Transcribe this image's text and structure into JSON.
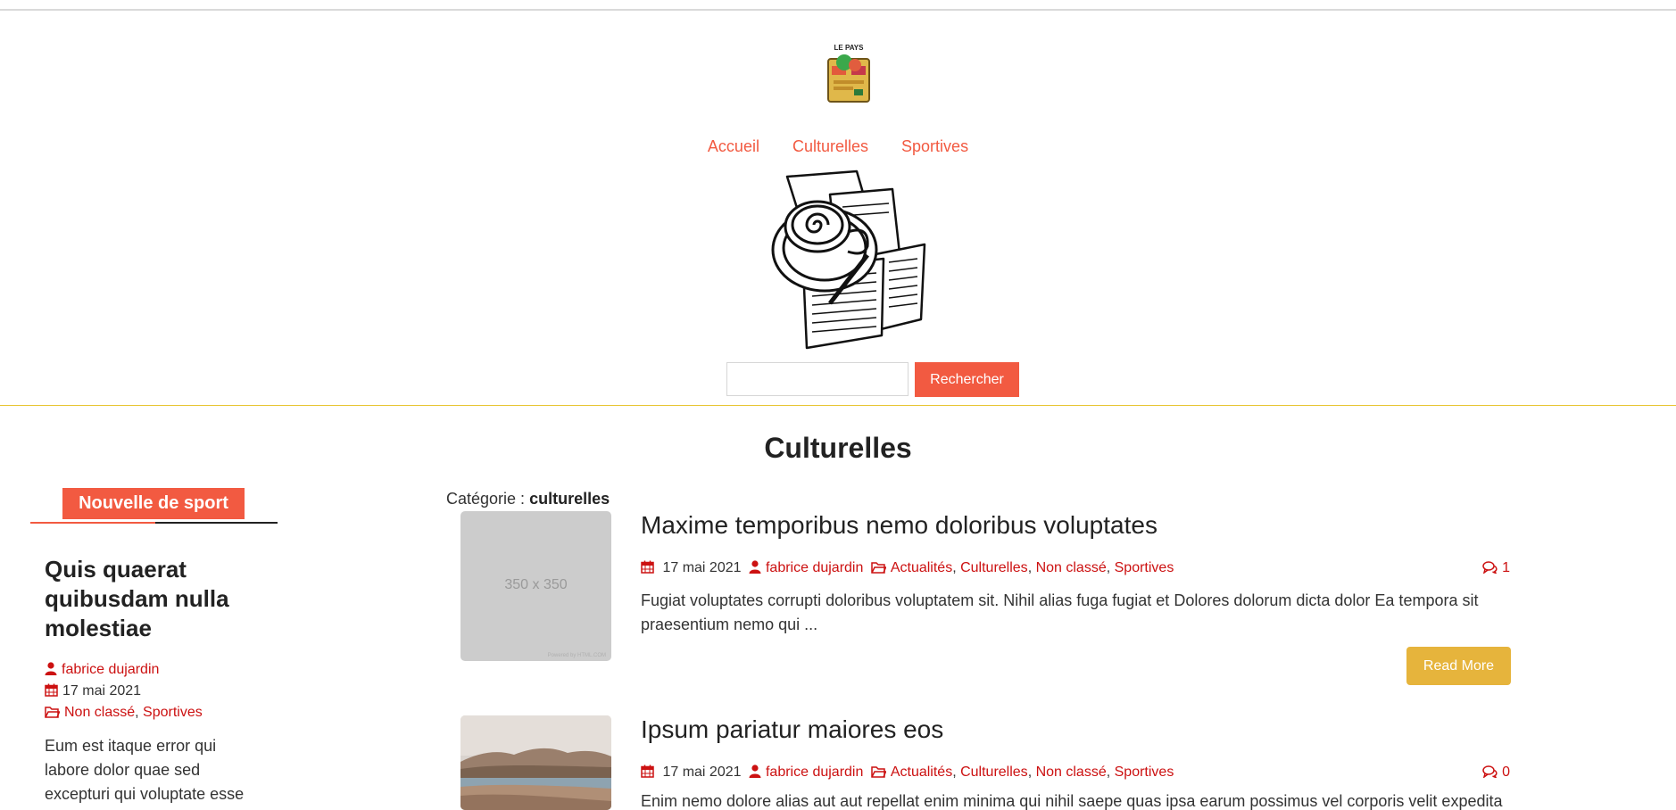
{
  "site": {
    "name": "LE PAYS"
  },
  "nav": {
    "items": [
      "Accueil",
      "Culturelles",
      "Sportives"
    ]
  },
  "search": {
    "value": "",
    "button_label": "Rechercher"
  },
  "page": {
    "title": "Culturelles"
  },
  "category": {
    "prefix": "Catégorie :",
    "name": "culturelles"
  },
  "sidebar": {
    "heading": "Nouvelle de sport",
    "post": {
      "title": "Quis quaerat quibusdam nulla molestiae",
      "author": "fabrice dujardin",
      "date": "17 mai 2021",
      "categories": [
        "Non classé",
        "Sportives"
      ],
      "excerpt": "Eum est itaque error qui labore dolor quae sed excepturi qui voluptate esse"
    }
  },
  "posts": [
    {
      "thumb_text": "350 x 350",
      "thumb_credit": "Powered by HTML.COM",
      "title": "Maxime temporibus nemo doloribus voluptates",
      "date": "17 mai 2021",
      "author": "fabrice dujardin",
      "categories": [
        "Actualités",
        "Culturelles",
        "Non classé",
        "Sportives"
      ],
      "comments": "1",
      "excerpt": "Fugiat voluptates corrupti doloribus voluptatem sit. Nihil alias fuga fugiat et Dolores dolorum dicta dolor Ea tempora sit praesentium nemo qui ...",
      "read_more": "Read More"
    },
    {
      "title": "Ipsum pariatur maiores eos",
      "date": "17 mai 2021",
      "author": "fabrice dujardin",
      "categories": [
        "Actualités",
        "Culturelles",
        "Non classé",
        "Sportives"
      ],
      "comments": "0",
      "excerpt": "Enim nemo dolore alias aut aut repellat enim minima qui nihil saepe quas ipsa earum possimus vel corporis velit expedita"
    }
  ],
  "icons": {
    "calendar": "calendar-icon",
    "user": "user-icon",
    "folder": "folder-icon",
    "comments": "comments-icon"
  },
  "colors": {
    "accent": "#f25a41",
    "meta_red": "#cc1111",
    "button_gold": "#e6b43c",
    "divider_yellow": "#e8c534"
  }
}
